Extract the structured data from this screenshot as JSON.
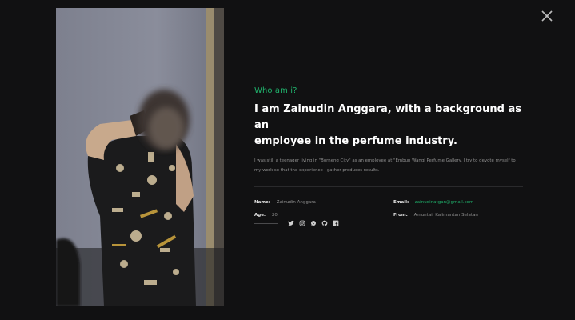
{
  "modal": {
    "close_icon": "close-icon"
  },
  "about": {
    "eyebrow": "Who am i?",
    "headline_line1": "I am Zainudin Anggara, with a background as an",
    "headline_line2": "employee in the perfume industry.",
    "description": "I was still a teenager living in \"Borneng City\" as an employee at \"Embun Wangi Perfume Gallery. I try to devote myself to my work so that the experience I gather produces results.",
    "info": {
      "name_label": "Name:",
      "name_value": "Zainudin Anggara",
      "age_label": "Age:",
      "age_value": "20",
      "email_label": "Email:",
      "email_value": "zainudinatgan@gmail.com",
      "from_label": "From:",
      "from_value": "Amuntai, Kalimantan Selatan"
    },
    "social_icons": [
      "twitter-icon",
      "instagram-icon",
      "whatsapp-icon",
      "github-icon",
      "facebook-icon"
    ]
  },
  "colors": {
    "background": "#111112",
    "accent": "#20b26c",
    "text_primary": "#ffffff",
    "text_muted": "#8f8f8f"
  }
}
